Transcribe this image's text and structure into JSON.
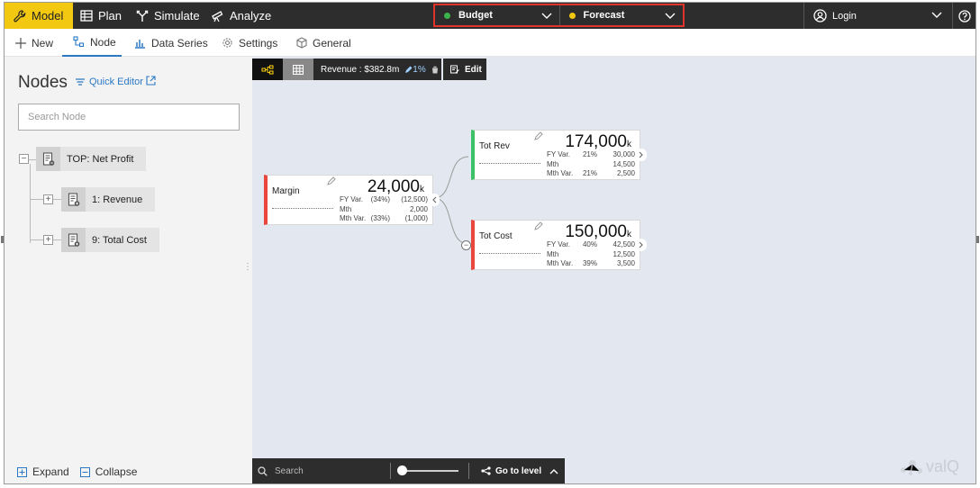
{
  "topbar": {
    "model": "Model",
    "plan": "Plan",
    "simulate": "Simulate",
    "analyze": "Analyze",
    "scenarios": [
      {
        "label": "Budget",
        "color": "#3cb44b"
      },
      {
        "label": "Forecast",
        "color": "#f2c811"
      }
    ],
    "login": "Login"
  },
  "toolbar": {
    "new": "New",
    "node": "Node",
    "data_series": "Data Series",
    "settings": "Settings",
    "general": "General"
  },
  "left_panel": {
    "title": "Nodes",
    "quick_editor": "Quick Editor",
    "search_placeholder": "Search Node",
    "tree": [
      {
        "label": "TOP: Net Profit",
        "toggle": "−"
      },
      {
        "label": "1: Revenue",
        "toggle": "+"
      },
      {
        "label": "9: Total Cost",
        "toggle": "+"
      }
    ],
    "expand": "Expand",
    "collapse": "Collapse"
  },
  "canvas": {
    "revenue_pill": "Revenue : $382.8m",
    "revenue_pct": "1%",
    "edit": "Edit",
    "cards": [
      {
        "name": "Margin",
        "value": "24,000",
        "unit": "k",
        "accent": "#e9463d",
        "rows": [
          {
            "label": "FY Var.",
            "pct": "(34%)",
            "value": "(12,500)"
          },
          {
            "label": "Mth",
            "pct": "",
            "value": "2,000"
          },
          {
            "label": "Mth Var.",
            "pct": "(33%)",
            "value": "(1,000)"
          }
        ]
      },
      {
        "name": "Tot Rev",
        "value": "174,000",
        "unit": "k",
        "accent": "#3cc36a",
        "rows": [
          {
            "label": "FY Var.",
            "pct": "21%",
            "value": "30,000"
          },
          {
            "label": "Mth",
            "pct": "",
            "value": "14,500"
          },
          {
            "label": "Mth Var.",
            "pct": "21%",
            "value": "2,500"
          }
        ]
      },
      {
        "name": "Tot Cost",
        "value": "150,000",
        "unit": "k",
        "accent": "#e9463d",
        "rows": [
          {
            "label": "FY Var.",
            "pct": "40%",
            "value": "42,500"
          },
          {
            "label": "Mth",
            "pct": "",
            "value": "12,500"
          },
          {
            "label": "Mth Var.",
            "pct": "39%",
            "value": "3,500"
          }
        ]
      }
    ],
    "search": "Search",
    "go_to_level": "Go to level",
    "brand": "valQ"
  }
}
